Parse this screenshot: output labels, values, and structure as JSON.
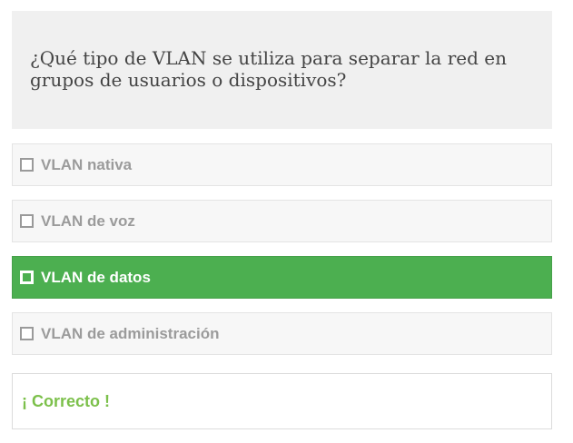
{
  "question": {
    "text": "¿Qué tipo de VLAN se utiliza para separar la red en grupos de usuarios o dispositivos?"
  },
  "options": [
    {
      "label": "VLAN nativa",
      "selected": false
    },
    {
      "label": "VLAN de voz",
      "selected": false
    },
    {
      "label": "VLAN de datos",
      "selected": true
    },
    {
      "label": "VLAN de administración",
      "selected": false
    }
  ],
  "feedback": {
    "text": "¡ Correcto !"
  },
  "colors": {
    "selected_background": "#4caf50",
    "feedback_text": "#7cc04b",
    "question_background": "#f0f0f0"
  },
  "icons": {
    "unchecked": "checkbox-empty-icon",
    "checked": "checkbox-checked-icon"
  }
}
